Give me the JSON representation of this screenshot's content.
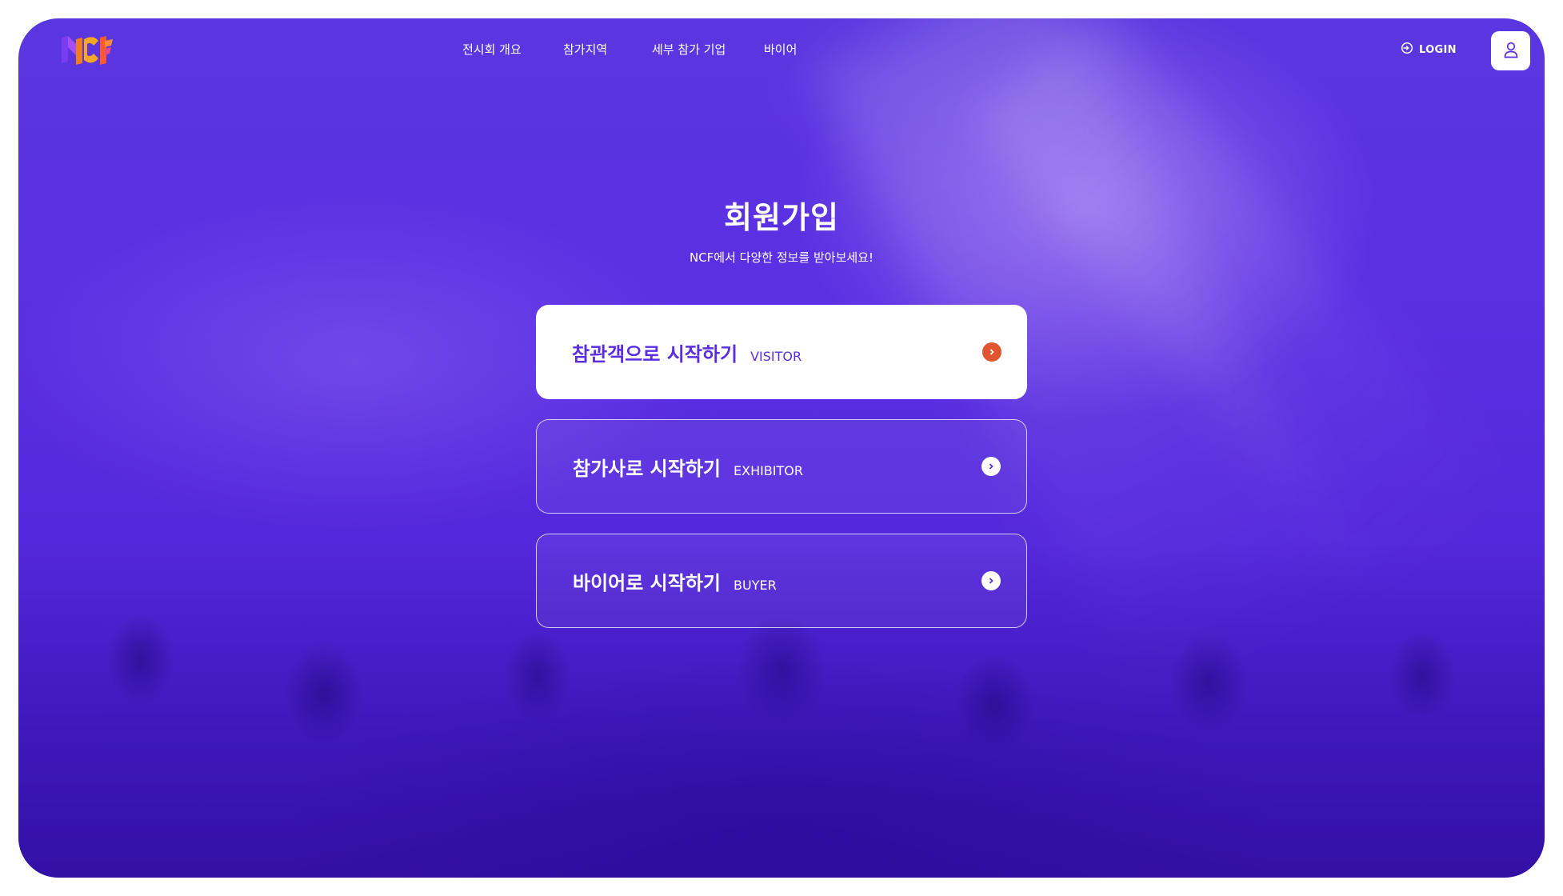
{
  "brand": {
    "logo": "NCF-logo"
  },
  "nav": {
    "items": [
      {
        "label": "전시회 개요"
      },
      {
        "label": "참가지역"
      },
      {
        "label": "세부 참가 기업"
      },
      {
        "label": "바이어"
      }
    ],
    "login_label": "LOGIN",
    "login_icon": "login-icon",
    "user_icon": "user-icon"
  },
  "main": {
    "title": "회원가입",
    "subtitle": "NCF에서 다양한 정보를 받아보세요!",
    "options": [
      {
        "title": "참관객으로 시작하기",
        "sub": "VISITOR",
        "icon": "chevron-right-icon"
      },
      {
        "title": "참가사로 시작하기",
        "sub": "EXHIBITOR",
        "icon": "chevron-right-icon"
      },
      {
        "title": "바이어로 시작하기",
        "sub": "BUYER",
        "icon": "chevron-right-icon"
      }
    ]
  },
  "colors": {
    "background": "#5a2fe2",
    "accent": "#5a2de0",
    "arrow_primary": "#e0552f",
    "white": "#ffffff"
  }
}
